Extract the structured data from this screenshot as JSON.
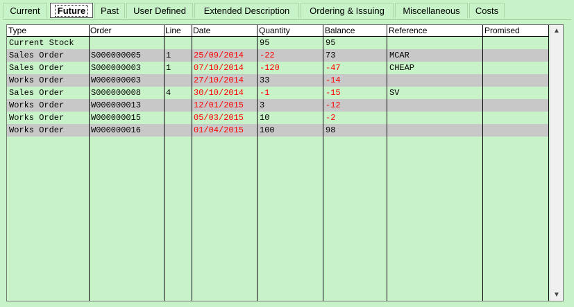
{
  "tabs": [
    {
      "label": "Current",
      "active": false
    },
    {
      "label": "Future",
      "active": true
    },
    {
      "label": "Past",
      "active": false
    },
    {
      "label": "User Defined",
      "active": false
    },
    {
      "label": "Extended Description",
      "active": false
    },
    {
      "label": "Ordering & Issuing",
      "active": false
    },
    {
      "label": "Miscellaneous",
      "active": false
    },
    {
      "label": "Costs",
      "active": false
    }
  ],
  "table": {
    "columns": [
      "Type",
      "Order",
      "Line",
      "Date",
      "Quantity",
      "Balance",
      "Reference",
      "Promised"
    ],
    "rows": [
      {
        "type": "Current Stock",
        "order": "",
        "line": "",
        "date": "",
        "quantity": "95",
        "balance": "95",
        "reference": "",
        "promised": "",
        "date_red": false,
        "qty_red": false,
        "bal_red": false
      },
      {
        "type": "Sales Order",
        "order": "S000000005",
        "line": "1",
        "date": "25/09/2014",
        "quantity": "-22",
        "balance": "73",
        "reference": "MCAR",
        "promised": "",
        "date_red": true,
        "qty_red": true,
        "bal_red": false
      },
      {
        "type": "Sales Order",
        "order": "S000000003",
        "line": "1",
        "date": "07/10/2014",
        "quantity": "-120",
        "balance": "-47",
        "reference": "CHEAP",
        "promised": "",
        "date_red": true,
        "qty_red": true,
        "bal_red": true
      },
      {
        "type": "Works Order",
        "order": "W000000003",
        "line": "",
        "date": "27/10/2014",
        "quantity": "33",
        "balance": "-14",
        "reference": "",
        "promised": "",
        "date_red": true,
        "qty_red": false,
        "bal_red": true
      },
      {
        "type": "Sales Order",
        "order": "S000000008",
        "line": "4",
        "date": "30/10/2014",
        "quantity": "-1",
        "balance": "-15",
        "reference": "SV",
        "promised": "",
        "date_red": true,
        "qty_red": true,
        "bal_red": true
      },
      {
        "type": "Works Order",
        "order": "W000000013",
        "line": "",
        "date": "12/01/2015",
        "quantity": "3",
        "balance": "-12",
        "reference": "",
        "promised": "",
        "date_red": true,
        "qty_red": false,
        "bal_red": true
      },
      {
        "type": "Works Order",
        "order": "W000000015",
        "line": "",
        "date": "05/03/2015",
        "quantity": "10",
        "balance": "-2",
        "reference": "",
        "promised": "",
        "date_red": true,
        "qty_red": false,
        "bal_red": true
      },
      {
        "type": "Works Order",
        "order": "W000000016",
        "line": "",
        "date": "01/04/2015",
        "quantity": "100",
        "balance": "98",
        "reference": "",
        "promised": "",
        "date_red": true,
        "qty_red": false,
        "bal_red": false
      }
    ]
  },
  "scrollbar": {
    "up_icon": "scroll-up-icon",
    "down_icon": "scroll-down-icon"
  }
}
